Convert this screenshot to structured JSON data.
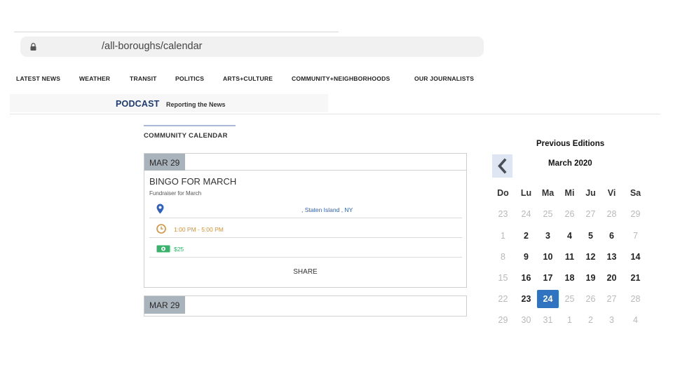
{
  "browser": {
    "url": "/all-boroughs/calendar"
  },
  "nav": {
    "items": [
      {
        "label": "LATEST NEWS"
      },
      {
        "label": "WEATHER"
      },
      {
        "label": "TRANSIT"
      },
      {
        "label": "POLITICS"
      },
      {
        "label": "ARTS+CULTURE"
      },
      {
        "label": "COMMUNITY+NEIGHBORHOODS"
      },
      {
        "label": "OUR JOURNALISTS"
      }
    ]
  },
  "promo": {
    "podcast": "PODCAST",
    "tagline": "Reporting the News"
  },
  "calendar_section": {
    "title": "COMMUNITY CALENDAR"
  },
  "event": {
    "date": "MAR 29",
    "title": "BINGO FOR MARCH",
    "subtitle": "Fundraiser for March",
    "location": ", Staten Island , NY",
    "time": "1:00 PM - 5:00 PM",
    "price": "$25",
    "share_label": "SHARE"
  },
  "event2": {
    "date": "MAR 29"
  },
  "sidebar": {
    "heading": "Previous Editions",
    "month": "March 2020",
    "weekdays": [
      "Do",
      "Lu",
      "Ma",
      "Mi",
      "Ju",
      "Vi",
      "Sa"
    ],
    "weeks": [
      [
        {
          "d": "23",
          "s": "muted"
        },
        {
          "d": "24",
          "s": "muted"
        },
        {
          "d": "25",
          "s": "muted"
        },
        {
          "d": "26",
          "s": "muted"
        },
        {
          "d": "27",
          "s": "muted"
        },
        {
          "d": "28",
          "s": "muted"
        },
        {
          "d": "29",
          "s": "muted"
        }
      ],
      [
        {
          "d": "1",
          "s": "muted"
        },
        {
          "d": "2",
          "s": "active"
        },
        {
          "d": "3",
          "s": "active"
        },
        {
          "d": "4",
          "s": "active"
        },
        {
          "d": "5",
          "s": "active"
        },
        {
          "d": "6",
          "s": "active"
        },
        {
          "d": "7",
          "s": "muted"
        }
      ],
      [
        {
          "d": "8",
          "s": "muted"
        },
        {
          "d": "9",
          "s": "active"
        },
        {
          "d": "10",
          "s": "active"
        },
        {
          "d": "11",
          "s": "active"
        },
        {
          "d": "12",
          "s": "active"
        },
        {
          "d": "13",
          "s": "active"
        },
        {
          "d": "14",
          "s": "active"
        }
      ],
      [
        {
          "d": "15",
          "s": "muted"
        },
        {
          "d": "16",
          "s": "active"
        },
        {
          "d": "17",
          "s": "active"
        },
        {
          "d": "18",
          "s": "active"
        },
        {
          "d": "19",
          "s": "active"
        },
        {
          "d": "20",
          "s": "active"
        },
        {
          "d": "21",
          "s": "active"
        }
      ],
      [
        {
          "d": "22",
          "s": "muted"
        },
        {
          "d": "23",
          "s": "active"
        },
        {
          "d": "24",
          "s": "selected"
        },
        {
          "d": "25",
          "s": "muted"
        },
        {
          "d": "26",
          "s": "muted"
        },
        {
          "d": "27",
          "s": "muted"
        },
        {
          "d": "28",
          "s": "muted"
        }
      ],
      [
        {
          "d": "29",
          "s": "muted"
        },
        {
          "d": "30",
          "s": "muted"
        },
        {
          "d": "31",
          "s": "muted"
        },
        {
          "d": "1",
          "s": "muted"
        },
        {
          "d": "2",
          "s": "muted"
        },
        {
          "d": "3",
          "s": "muted"
        },
        {
          "d": "4",
          "s": "muted"
        }
      ]
    ]
  },
  "icons": {
    "lock": "lock-icon",
    "location": "map-pin-icon",
    "time": "clock-icon",
    "price": "money-icon",
    "prev": "chevron-left-icon"
  },
  "colors": {
    "brand_navy": "#1c3a73",
    "pin_blue": "#2f5fbf",
    "clock_orange": "#d2913a",
    "money_green": "#37b36b",
    "selected_day": "#2f73c1",
    "date_tab": "#a9b3bb"
  }
}
